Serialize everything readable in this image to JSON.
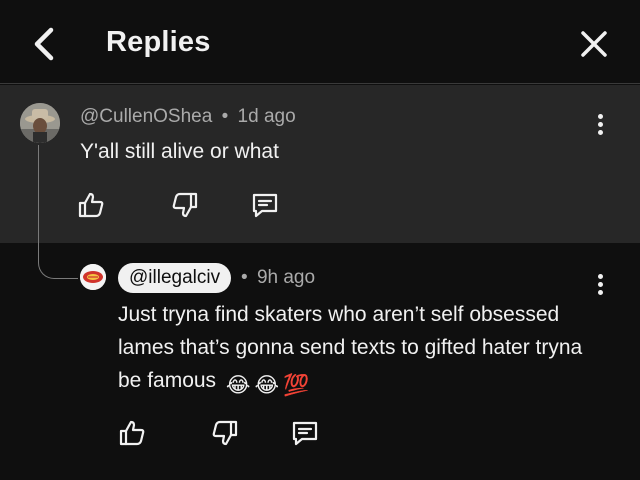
{
  "header": {
    "title": "Replies"
  },
  "parent_comment": {
    "author": "@CullenOShea",
    "separator": "•",
    "time": "1d ago",
    "text": "Y'all still alive or what"
  },
  "reply": {
    "author": "@illegalciv",
    "separator": "•",
    "time": "9h ago",
    "text": "Just tryna find skaters who aren’t self obsessed lames that’s gonna send texts to gifted hater tryna be famous",
    "emojis": [
      "😂",
      "😂",
      "💯"
    ]
  },
  "icons": {
    "back": "chevron-left-icon",
    "close": "close-icon",
    "like": "thumbs-up-icon",
    "dislike": "thumbs-down-icon",
    "reply": "reply-comment-icon",
    "more": "more-vertical-icon"
  },
  "colors": {
    "background": "#0f0f0f",
    "highlight": "#272727",
    "text": "#f1f1f1",
    "muted": "#aaaaaa"
  }
}
